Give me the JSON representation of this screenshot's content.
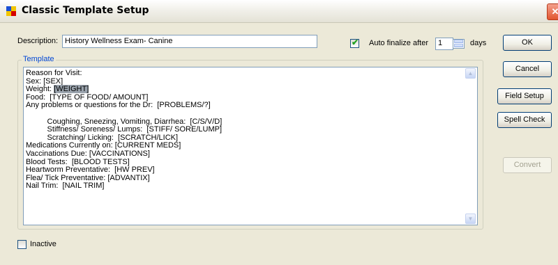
{
  "window": {
    "title": "Classic Template Setup",
    "close_glyph": "✕"
  },
  "form": {
    "description_label": "Description:",
    "description_value": "History Wellness Exam- Canine",
    "auto_finalize_label": "Auto finalize after",
    "auto_finalize_checked": true,
    "auto_finalize_value": "1",
    "days_label": "days",
    "template_group_label": "Template",
    "inactive_label": "Inactive",
    "inactive_checked": false
  },
  "template_lines": [
    {
      "text": "Reason for Visit:"
    },
    {
      "text": "Sex: [SEX]"
    },
    {
      "prefix": "Weight: ",
      "highlight": "[WEIGHT]"
    },
    {
      "text": "Food:  [TYPE OF FOOD/ AMOUNT]"
    },
    {
      "text": "Any problems or questions for the Dr:  [PROBLEMS/?]"
    },
    {
      "text": ""
    },
    {
      "text": "          Coughing, Sneezing, Vomiting, Diarrhea:  [C/S/V/D]"
    },
    {
      "text": "          Stiffness/ Soreness/ Lumps:  [STIFF/ SORE/LUMP]"
    },
    {
      "text": "          Scratching/ Licking:  [SCRATCH/LICK]"
    },
    {
      "text": "Medications Currently on: [CURRENT MEDS]"
    },
    {
      "text": "Vaccinations Due: [VACCINATIONS]"
    },
    {
      "text": "Blood Tests:  [BLOOD TESTS]"
    },
    {
      "text": "Heartworm Preventative:  [HW PREV]"
    },
    {
      "text": "Flea/ Tick Preventative: [ADVANTIX]"
    },
    {
      "text": "Nail Trim:  [NAIL TRIM]"
    }
  ],
  "buttons": {
    "ok": "OK",
    "cancel": "Cancel",
    "field_setup": "Field Setup",
    "spell_check": "Spell Check",
    "convert": "Convert"
  },
  "scroll": {
    "up_glyph": "▲",
    "down_glyph": "▼"
  },
  "colors": {
    "highlight": "#9aa3ad",
    "checkmark": "#21a121",
    "close_button": "#e2552f"
  }
}
